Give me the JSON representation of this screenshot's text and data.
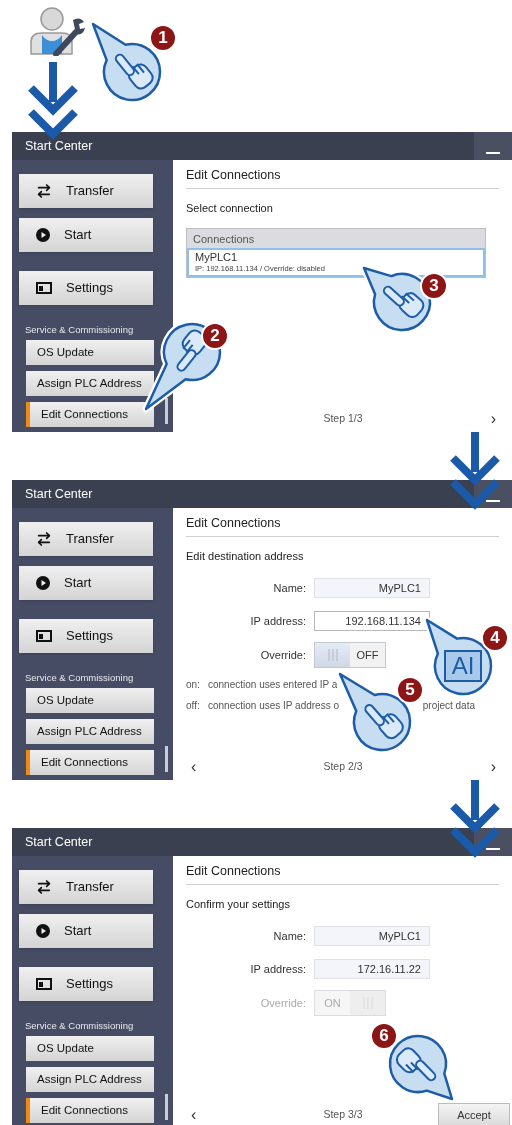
{
  "panels": [
    {
      "title": "Start Center",
      "minimize": true,
      "sidebar": {
        "main_items": [
          {
            "label": "Transfer"
          },
          {
            "label": "Start"
          },
          {
            "label": "Settings"
          }
        ],
        "section": "Service & Commissioning",
        "sub_items": [
          {
            "label": "OS Update",
            "selected": false
          },
          {
            "label": "Assign PLC Address",
            "selected": false
          },
          {
            "label": "Edit Connections",
            "selected": true
          }
        ]
      },
      "content": {
        "title": "Edit Connections",
        "subtitle": "Select connection",
        "kind": "list",
        "list_header": "Connections",
        "rows": [
          {
            "name": "MyPLC1",
            "detail": "IP: 192.168.11.134 / Override: disabled",
            "selected": true
          }
        ]
      },
      "nav": {
        "step": "Step 1/3",
        "next": "›"
      }
    },
    {
      "title": "Start Center",
      "minimize": true,
      "sidebar": {
        "main_items": [
          {
            "label": "Transfer"
          },
          {
            "label": "Start"
          },
          {
            "label": "Settings"
          }
        ],
        "section": "Service & Commissioning",
        "sub_items": [
          {
            "label": "OS Update",
            "selected": false
          },
          {
            "label": "Assign PLC Address",
            "selected": false
          },
          {
            "label": "Edit Connections",
            "selected": true
          }
        ]
      },
      "content": {
        "title": "Edit Connections",
        "subtitle": "Edit destination address",
        "kind": "form",
        "fields": [
          {
            "label": "Name:",
            "value": "MyPLC1",
            "editable": false
          },
          {
            "label": "IP address:",
            "value": "192.168.11.134",
            "editable": true
          }
        ],
        "toggle": {
          "label": "Override:",
          "text": "OFF",
          "on": false,
          "disabled": false
        },
        "notes": [
          {
            "key": "on:",
            "text": "connection uses entered IP a"
          },
          {
            "key": "off:",
            "text": "connection uses IP address o",
            "text_after": "project data"
          }
        ]
      },
      "nav": {
        "back": "‹",
        "step": "Step 2/3",
        "next": "›"
      }
    },
    {
      "title": "Start Center",
      "minimize": true,
      "sidebar": {
        "main_items": [
          {
            "label": "Transfer"
          },
          {
            "label": "Start"
          },
          {
            "label": "Settings"
          }
        ],
        "section": "Service & Commissioning",
        "sub_items": [
          {
            "label": "OS Update",
            "selected": false
          },
          {
            "label": "Assign PLC Address",
            "selected": false
          },
          {
            "label": "Edit Connections",
            "selected": true
          }
        ]
      },
      "content": {
        "title": "Edit Connections",
        "subtitle": "Confirm your settings",
        "kind": "form",
        "fields": [
          {
            "label": "Name:",
            "value": "MyPLC1",
            "editable": false
          },
          {
            "label": "IP address:",
            "value": "172.16.11.22",
            "editable": false
          }
        ],
        "toggle": {
          "label": "Override:",
          "text": "ON",
          "on": true,
          "disabled": true
        }
      },
      "nav": {
        "back": "‹",
        "step": "Step 3/3",
        "action": "Accept"
      }
    }
  ],
  "callouts": [
    {
      "number": "1",
      "kind": "tap"
    },
    {
      "number": "2",
      "kind": "tap"
    },
    {
      "number": "3",
      "kind": "tap"
    },
    {
      "number": "4",
      "kind": "type",
      "glyph": "AI"
    },
    {
      "number": "5",
      "kind": "tap"
    },
    {
      "number": "6",
      "kind": "tap"
    }
  ]
}
